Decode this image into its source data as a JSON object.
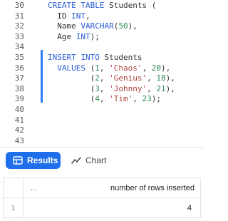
{
  "editor": {
    "line_numbers": [
      "30",
      "31",
      "32",
      "33",
      "34",
      "35",
      "36",
      "37",
      "38",
      "39",
      "40",
      "41",
      "42",
      "43"
    ],
    "lines": [
      [
        {
          "t": "CREATE TABLE ",
          "c": "kw"
        },
        {
          "t": "Students (",
          "c": "tx"
        }
      ],
      [
        {
          "t": "  ID ",
          "c": "tx"
        },
        {
          "t": "INT",
          "c": "kw"
        },
        {
          "t": ",",
          "c": "tx"
        }
      ],
      [
        {
          "t": "  Name ",
          "c": "tx"
        },
        {
          "t": "VARCHAR",
          "c": "kw"
        },
        {
          "t": "(",
          "c": "tx"
        },
        {
          "t": "50",
          "c": "num"
        },
        {
          "t": "),",
          "c": "tx"
        }
      ],
      [
        {
          "t": "  Age ",
          "c": "tx"
        },
        {
          "t": "INT",
          "c": "kw"
        },
        {
          "t": ");",
          "c": "tx"
        }
      ],
      [],
      [
        {
          "t": "INSERT INTO ",
          "c": "kw"
        },
        {
          "t": "Students",
          "c": "tx"
        }
      ],
      [
        {
          "t": "  VALUES ",
          "c": "kw"
        },
        {
          "t": "(",
          "c": "tx"
        },
        {
          "t": "1",
          "c": "num"
        },
        {
          "t": ", ",
          "c": "tx"
        },
        {
          "t": "'Chaos'",
          "c": "str"
        },
        {
          "t": ", ",
          "c": "tx"
        },
        {
          "t": "20",
          "c": "num"
        },
        {
          "t": "),",
          "c": "tx"
        }
      ],
      [
        {
          "t": "         (",
          "c": "tx"
        },
        {
          "t": "2",
          "c": "num"
        },
        {
          "t": ", ",
          "c": "tx"
        },
        {
          "t": "'Genius'",
          "c": "str"
        },
        {
          "t": ", ",
          "c": "tx"
        },
        {
          "t": "18",
          "c": "num"
        },
        {
          "t": "),",
          "c": "tx"
        }
      ],
      [
        {
          "t": "         (",
          "c": "tx"
        },
        {
          "t": "3",
          "c": "num"
        },
        {
          "t": ", ",
          "c": "tx"
        },
        {
          "t": "'Johnny'",
          "c": "str"
        },
        {
          "t": ", ",
          "c": "tx"
        },
        {
          "t": "21",
          "c": "num"
        },
        {
          "t": "),",
          "c": "tx"
        }
      ],
      [
        {
          "t": "         (",
          "c": "tx"
        },
        {
          "t": "4",
          "c": "num"
        },
        {
          "t": ", ",
          "c": "tx"
        },
        {
          "t": "'Tim'",
          "c": "str"
        },
        {
          "t": ", ",
          "c": "tx"
        },
        {
          "t": "23",
          "c": "num"
        },
        {
          "t": ");",
          "c": "tx"
        }
      ],
      [],
      [],
      [],
      []
    ]
  },
  "tabs": {
    "results_label": "Results",
    "chart_label": "Chart",
    "results_icon": "results-table-icon",
    "chart_icon": "chart-line-icon"
  },
  "results": {
    "dots": "...",
    "column_header": "number of rows inserted",
    "rows": [
      {
        "index": "1",
        "value": "4"
      }
    ]
  },
  "colors": {
    "accent": "#1f6feb",
    "keyword": "#2a5bd7",
    "string": "#b0403a",
    "number": "#2e8b57"
  }
}
